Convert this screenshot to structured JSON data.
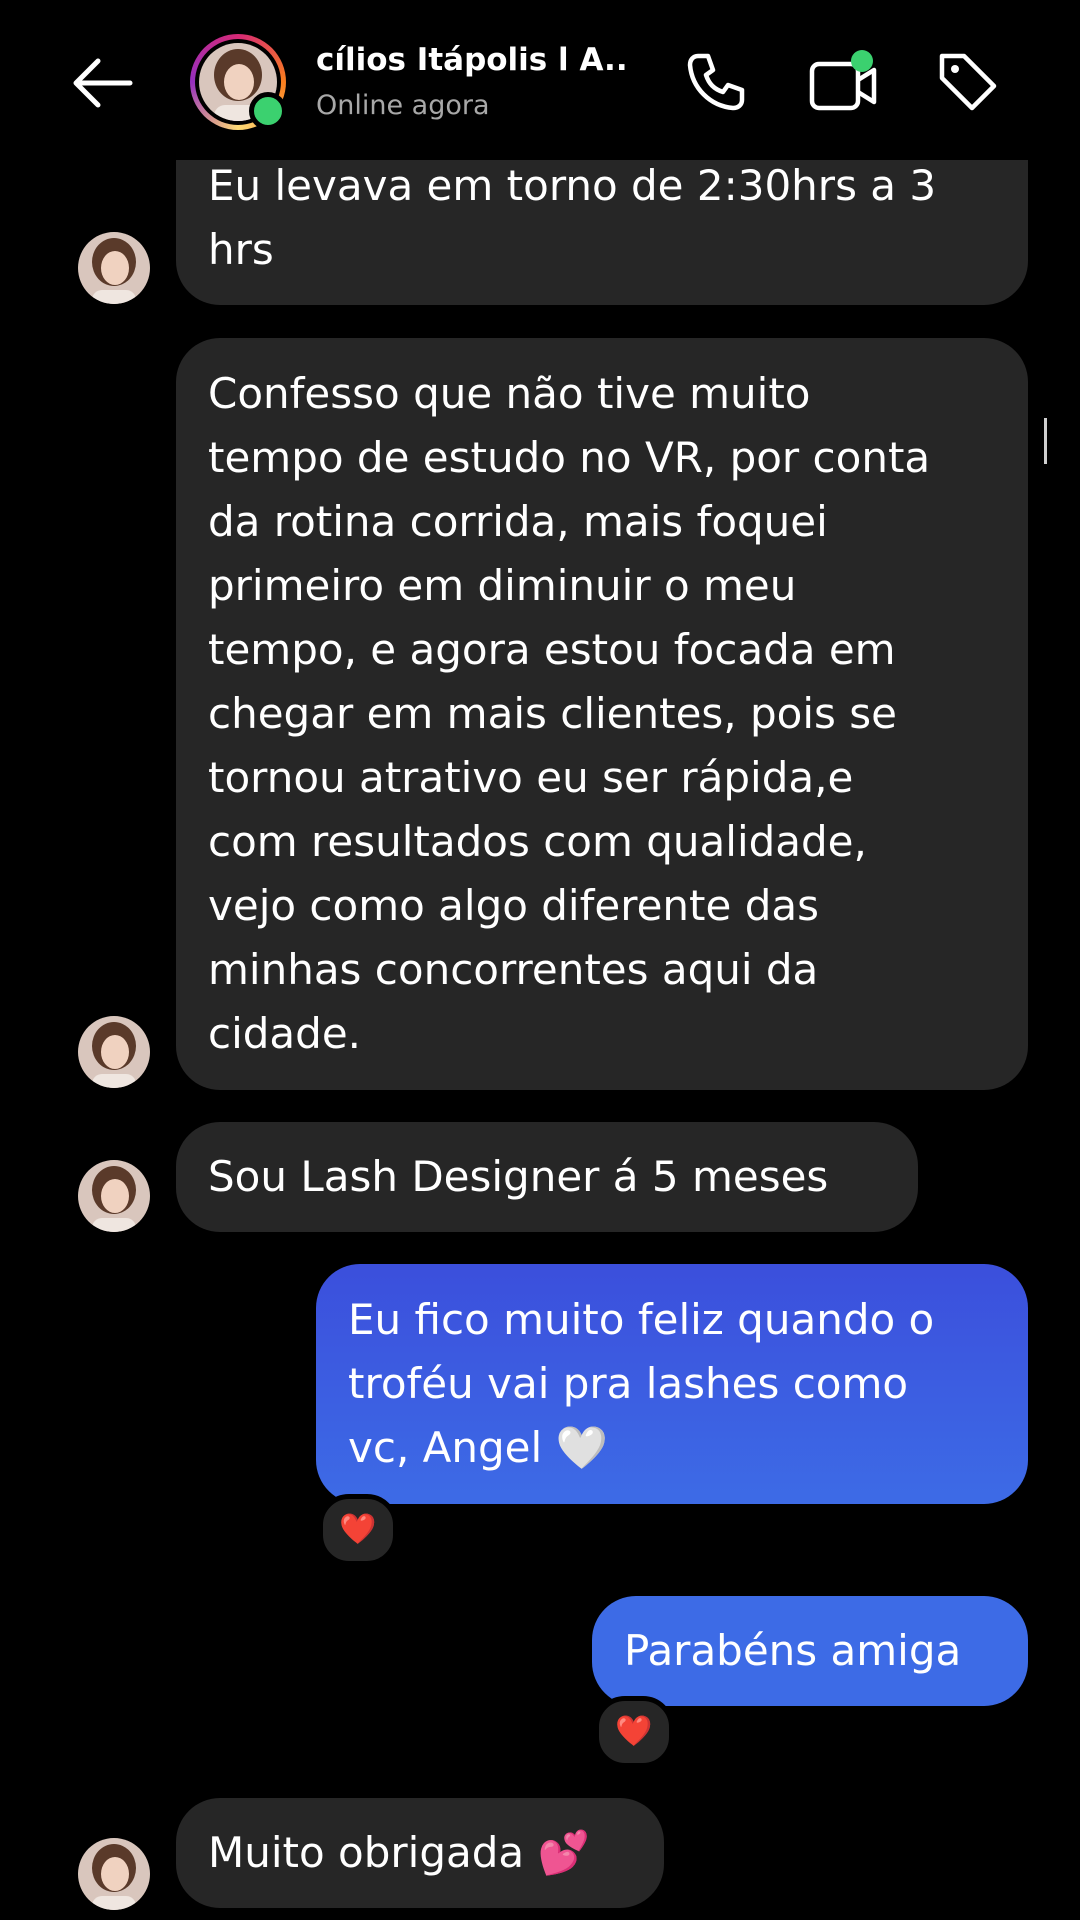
{
  "header": {
    "contact_name": "cílios Itápolis l A...",
    "status": "Online agora",
    "icons": [
      "back-arrow-icon",
      "phone-icon",
      "video-camera-icon",
      "tag-icon"
    ],
    "online_color": "#3bd16f"
  },
  "messages": [
    {
      "direction": "incoming",
      "text": "Eu levava em torno de 2:30hrs a 3\nhrs"
    },
    {
      "direction": "incoming",
      "text": "Confesso que não tive muito\ntempo de estudo no VR, por conta\nda rotina corrida, mais foquei\nprimeiro em diminuir o meu\ntempo, e agora estou focada em\nchegar em mais clientes, pois se\ntornou atrativo eu ser rápida,e\ncom resultados com qualidade,\nvejo como algo diferente das\nminhas concorrentes aqui da\ncidade."
    },
    {
      "direction": "incoming",
      "text": "Sou Lash Designer á 5 meses"
    },
    {
      "direction": "outgoing",
      "text": "Eu fico muito feliz quando o\ntroféu vai pra lashes como\nvc, Angel 🤍",
      "reaction": "❤️"
    },
    {
      "direction": "outgoing",
      "text": "Parabéns amiga",
      "reaction": "❤️"
    },
    {
      "direction": "incoming",
      "text": "Muito obrigada 💕"
    }
  ],
  "colors": {
    "background": "#000000",
    "incoming_bubble": "#262626",
    "outgoing_bubble": "#3a5bdf",
    "secondary_text": "#a8a8a8"
  }
}
